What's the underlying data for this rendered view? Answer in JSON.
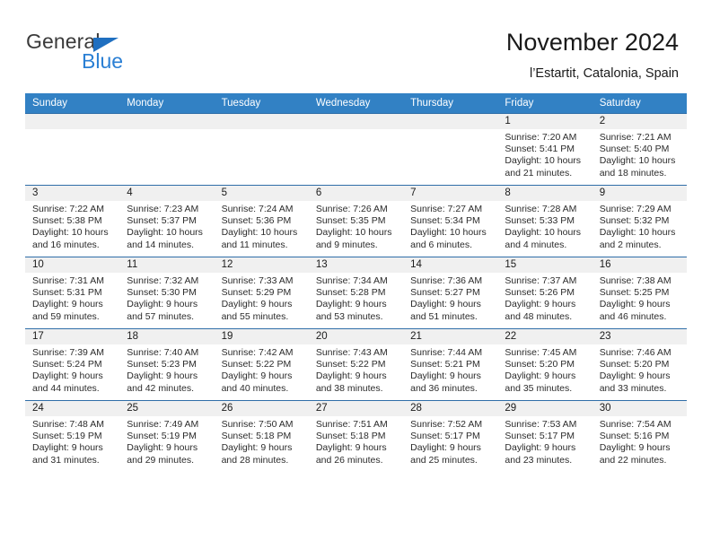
{
  "brand": {
    "name_top": "General",
    "name_bottom": "Blue",
    "accent_color": "#2a7fd4",
    "triangle_color": "#1f6fc0"
  },
  "header": {
    "title": "November 2024",
    "subtitle": "l’Estartit, Catalonia, Spain"
  },
  "theme": {
    "header_row_bg": "#3281c4",
    "header_row_text": "#ffffff",
    "daynum_band_bg": "#f0f0f0",
    "row_divider": "#2f6ea8",
    "body_text": "#2b2b2b"
  },
  "weekdays": [
    "Sunday",
    "Monday",
    "Tuesday",
    "Wednesday",
    "Thursday",
    "Friday",
    "Saturday"
  ],
  "labels": {
    "sunrise_prefix": "Sunrise:",
    "sunset_prefix": "Sunset:",
    "daylight_prefix": "Daylight:"
  },
  "weeks": [
    [
      {
        "day": "",
        "sunrise": "",
        "sunset": "",
        "daylight_line1": "",
        "daylight_line2": ""
      },
      {
        "day": "",
        "sunrise": "",
        "sunset": "",
        "daylight_line1": "",
        "daylight_line2": ""
      },
      {
        "day": "",
        "sunrise": "",
        "sunset": "",
        "daylight_line1": "",
        "daylight_line2": ""
      },
      {
        "day": "",
        "sunrise": "",
        "sunset": "",
        "daylight_line1": "",
        "daylight_line2": ""
      },
      {
        "day": "",
        "sunrise": "",
        "sunset": "",
        "daylight_line1": "",
        "daylight_line2": ""
      },
      {
        "day": "1",
        "sunrise": "Sunrise: 7:20 AM",
        "sunset": "Sunset: 5:41 PM",
        "daylight_line1": "Daylight: 10 hours",
        "daylight_line2": "and 21 minutes."
      },
      {
        "day": "2",
        "sunrise": "Sunrise: 7:21 AM",
        "sunset": "Sunset: 5:40 PM",
        "daylight_line1": "Daylight: 10 hours",
        "daylight_line2": "and 18 minutes."
      }
    ],
    [
      {
        "day": "3",
        "sunrise": "Sunrise: 7:22 AM",
        "sunset": "Sunset: 5:38 PM",
        "daylight_line1": "Daylight: 10 hours",
        "daylight_line2": "and 16 minutes."
      },
      {
        "day": "4",
        "sunrise": "Sunrise: 7:23 AM",
        "sunset": "Sunset: 5:37 PM",
        "daylight_line1": "Daylight: 10 hours",
        "daylight_line2": "and 14 minutes."
      },
      {
        "day": "5",
        "sunrise": "Sunrise: 7:24 AM",
        "sunset": "Sunset: 5:36 PM",
        "daylight_line1": "Daylight: 10 hours",
        "daylight_line2": "and 11 minutes."
      },
      {
        "day": "6",
        "sunrise": "Sunrise: 7:26 AM",
        "sunset": "Sunset: 5:35 PM",
        "daylight_line1": "Daylight: 10 hours",
        "daylight_line2": "and 9 minutes."
      },
      {
        "day": "7",
        "sunrise": "Sunrise: 7:27 AM",
        "sunset": "Sunset: 5:34 PM",
        "daylight_line1": "Daylight: 10 hours",
        "daylight_line2": "and 6 minutes."
      },
      {
        "day": "8",
        "sunrise": "Sunrise: 7:28 AM",
        "sunset": "Sunset: 5:33 PM",
        "daylight_line1": "Daylight: 10 hours",
        "daylight_line2": "and 4 minutes."
      },
      {
        "day": "9",
        "sunrise": "Sunrise: 7:29 AM",
        "sunset": "Sunset: 5:32 PM",
        "daylight_line1": "Daylight: 10 hours",
        "daylight_line2": "and 2 minutes."
      }
    ],
    [
      {
        "day": "10",
        "sunrise": "Sunrise: 7:31 AM",
        "sunset": "Sunset: 5:31 PM",
        "daylight_line1": "Daylight: 9 hours",
        "daylight_line2": "and 59 minutes."
      },
      {
        "day": "11",
        "sunrise": "Sunrise: 7:32 AM",
        "sunset": "Sunset: 5:30 PM",
        "daylight_line1": "Daylight: 9 hours",
        "daylight_line2": "and 57 minutes."
      },
      {
        "day": "12",
        "sunrise": "Sunrise: 7:33 AM",
        "sunset": "Sunset: 5:29 PM",
        "daylight_line1": "Daylight: 9 hours",
        "daylight_line2": "and 55 minutes."
      },
      {
        "day": "13",
        "sunrise": "Sunrise: 7:34 AM",
        "sunset": "Sunset: 5:28 PM",
        "daylight_line1": "Daylight: 9 hours",
        "daylight_line2": "and 53 minutes."
      },
      {
        "day": "14",
        "sunrise": "Sunrise: 7:36 AM",
        "sunset": "Sunset: 5:27 PM",
        "daylight_line1": "Daylight: 9 hours",
        "daylight_line2": "and 51 minutes."
      },
      {
        "day": "15",
        "sunrise": "Sunrise: 7:37 AM",
        "sunset": "Sunset: 5:26 PM",
        "daylight_line1": "Daylight: 9 hours",
        "daylight_line2": "and 48 minutes."
      },
      {
        "day": "16",
        "sunrise": "Sunrise: 7:38 AM",
        "sunset": "Sunset: 5:25 PM",
        "daylight_line1": "Daylight: 9 hours",
        "daylight_line2": "and 46 minutes."
      }
    ],
    [
      {
        "day": "17",
        "sunrise": "Sunrise: 7:39 AM",
        "sunset": "Sunset: 5:24 PM",
        "daylight_line1": "Daylight: 9 hours",
        "daylight_line2": "and 44 minutes."
      },
      {
        "day": "18",
        "sunrise": "Sunrise: 7:40 AM",
        "sunset": "Sunset: 5:23 PM",
        "daylight_line1": "Daylight: 9 hours",
        "daylight_line2": "and 42 minutes."
      },
      {
        "day": "19",
        "sunrise": "Sunrise: 7:42 AM",
        "sunset": "Sunset: 5:22 PM",
        "daylight_line1": "Daylight: 9 hours",
        "daylight_line2": "and 40 minutes."
      },
      {
        "day": "20",
        "sunrise": "Sunrise: 7:43 AM",
        "sunset": "Sunset: 5:22 PM",
        "daylight_line1": "Daylight: 9 hours",
        "daylight_line2": "and 38 minutes."
      },
      {
        "day": "21",
        "sunrise": "Sunrise: 7:44 AM",
        "sunset": "Sunset: 5:21 PM",
        "daylight_line1": "Daylight: 9 hours",
        "daylight_line2": "and 36 minutes."
      },
      {
        "day": "22",
        "sunrise": "Sunrise: 7:45 AM",
        "sunset": "Sunset: 5:20 PM",
        "daylight_line1": "Daylight: 9 hours",
        "daylight_line2": "and 35 minutes."
      },
      {
        "day": "23",
        "sunrise": "Sunrise: 7:46 AM",
        "sunset": "Sunset: 5:20 PM",
        "daylight_line1": "Daylight: 9 hours",
        "daylight_line2": "and 33 minutes."
      }
    ],
    [
      {
        "day": "24",
        "sunrise": "Sunrise: 7:48 AM",
        "sunset": "Sunset: 5:19 PM",
        "daylight_line1": "Daylight: 9 hours",
        "daylight_line2": "and 31 minutes."
      },
      {
        "day": "25",
        "sunrise": "Sunrise: 7:49 AM",
        "sunset": "Sunset: 5:19 PM",
        "daylight_line1": "Daylight: 9 hours",
        "daylight_line2": "and 29 minutes."
      },
      {
        "day": "26",
        "sunrise": "Sunrise: 7:50 AM",
        "sunset": "Sunset: 5:18 PM",
        "daylight_line1": "Daylight: 9 hours",
        "daylight_line2": "and 28 minutes."
      },
      {
        "day": "27",
        "sunrise": "Sunrise: 7:51 AM",
        "sunset": "Sunset: 5:18 PM",
        "daylight_line1": "Daylight: 9 hours",
        "daylight_line2": "and 26 minutes."
      },
      {
        "day": "28",
        "sunrise": "Sunrise: 7:52 AM",
        "sunset": "Sunset: 5:17 PM",
        "daylight_line1": "Daylight: 9 hours",
        "daylight_line2": "and 25 minutes."
      },
      {
        "day": "29",
        "sunrise": "Sunrise: 7:53 AM",
        "sunset": "Sunset: 5:17 PM",
        "daylight_line1": "Daylight: 9 hours",
        "daylight_line2": "and 23 minutes."
      },
      {
        "day": "30",
        "sunrise": "Sunrise: 7:54 AM",
        "sunset": "Sunset: 5:16 PM",
        "daylight_line1": "Daylight: 9 hours",
        "daylight_line2": "and 22 minutes."
      }
    ]
  ]
}
